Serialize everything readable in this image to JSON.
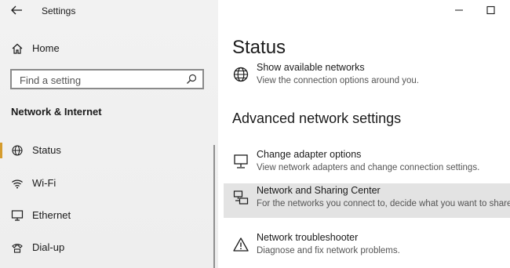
{
  "window": {
    "title": "Settings",
    "back_icon": "back-arrow-icon",
    "minimize_icon": "minimize-icon",
    "maximize_icon": "maximize-icon"
  },
  "sidebar": {
    "home_label": "Home",
    "search_placeholder": "Find a setting",
    "section_header": "Network & Internet",
    "items": [
      {
        "label": "Status",
        "icon": "status-icon",
        "active": true
      },
      {
        "label": "Wi-Fi",
        "icon": "wifi-icon",
        "active": false
      },
      {
        "label": "Ethernet",
        "icon": "ethernet-icon",
        "active": false
      },
      {
        "label": "Dial-up",
        "icon": "dialup-icon",
        "active": false
      }
    ],
    "accent_color": "#d59c2e"
  },
  "main": {
    "title": "Status",
    "top_entry": {
      "title": "Show available networks",
      "description": "View the connection options around you.",
      "icon": "globe-icon"
    },
    "advanced_header": "Advanced network settings",
    "advanced_entries": [
      {
        "title": "Change adapter options",
        "description": "View network adapters and change connection settings.",
        "icon": "monitor-icon",
        "highlighted": false
      },
      {
        "title": "Network and Sharing Center",
        "description": "For the networks you connect to, decide what you want to share.",
        "icon": "sharing-center-icon",
        "highlighted": true
      },
      {
        "title": "Network troubleshooter",
        "description": "Diagnose and fix network problems.",
        "icon": "warning-icon",
        "highlighted": false
      }
    ],
    "highlight_color": "#e3e3e3"
  }
}
